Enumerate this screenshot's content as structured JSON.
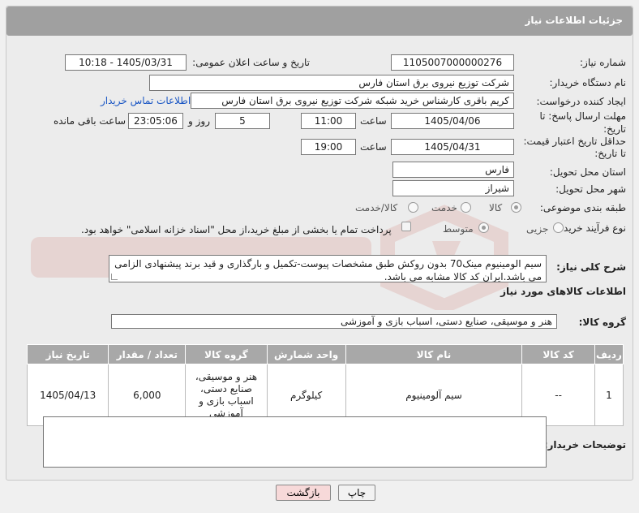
{
  "header": {
    "title": "جزئیات اطلاعات نیاز"
  },
  "fields": {
    "need_number_label": "شماره نیاز:",
    "need_number": "1105007000000276",
    "announce_label": "تاریخ و ساعت اعلان عمومی:",
    "announce_value": "1405/03/31 - 10:18",
    "buyer_org_label": "نام دستگاه خریدار:",
    "buyer_org": "شرکت توزیع نیروی برق استان فارس",
    "creator_label": "ایجاد کننده درخواست:",
    "creator": "کریم باقری کارشناس خرید شبکه شرکت توزیع نیروی برق استان فارس",
    "contact_link": "اطلاعات تماس خریدار",
    "deadline_label_1": "مهلت ارسال پاسخ: تا",
    "deadline_label_2": "تاریخ:",
    "deadline_date": "1405/04/06",
    "time_label": "ساعت",
    "deadline_time": "11:00",
    "days_value": "5",
    "days_label": "روز و",
    "remaining_time": "23:05:06",
    "remaining_label": "ساعت باقی مانده",
    "min_validity_label_1": "حداقل تاریخ اعتبار قیمت:",
    "min_validity_label_2": "تا تاریخ:",
    "validity_date": "1405/04/31",
    "validity_time": "19:00",
    "province_label": "استان محل تحویل:",
    "province": "فارس",
    "city_label": "شهر محل تحویل:",
    "city": "شیراز",
    "category_label": "طبقه بندی موضوعی:",
    "category_options": [
      "کالا",
      "خدمت",
      "کالا/خدمت"
    ],
    "category_selected": "کالا",
    "process_label": "نوع فرآیند خرید :",
    "process_options": [
      "جزیی",
      "متوسط"
    ],
    "process_selected": "متوسط",
    "payment_note": "پرداخت تمام یا بخشی از مبلغ خرید،از محل \"اسناد خزانه اسلامی\" خواهد بود."
  },
  "description": {
    "label": "شرح کلی نیاز:",
    "text": "سیم الومینیوم مینک70 بدون روکش طبق مشخصات پیوست-تکمیل و بارگذاری و قید برند پیشنهادی الزامی می باشد.ایران کد کالا مشابه می باشد."
  },
  "goods": {
    "section_title": "اطلاعات کالاهای مورد نیاز",
    "group_label": "گروه کالا:",
    "group_value": "هنر و موسیقی، صنایع دستی، اسباب بازی و آموزشی",
    "columns": [
      "ردیف",
      "کد کالا",
      "نام کالا",
      "واحد شمارش",
      "گروه کالا",
      "تعداد / مقدار",
      "تاریخ نیاز"
    ],
    "rows": [
      {
        "row": "1",
        "code": "--",
        "name": "سیم آلومینیوم",
        "unit": "کیلوگرم",
        "group": "هنر و موسیقی، صنایع دستی، اسباب بازی و آموزشی",
        "qty": "6,000",
        "date": "1405/04/13"
      }
    ]
  },
  "buyer_notes": {
    "label": "توضیحات خریدار:",
    "value": ""
  },
  "buttons": {
    "print": "چاپ",
    "back": "بازگشت"
  },
  "colors": {
    "header": "#a0a0a0",
    "link": "#1a56c4",
    "back_button": "#f7d9d9",
    "watermark": "#c0392b"
  }
}
